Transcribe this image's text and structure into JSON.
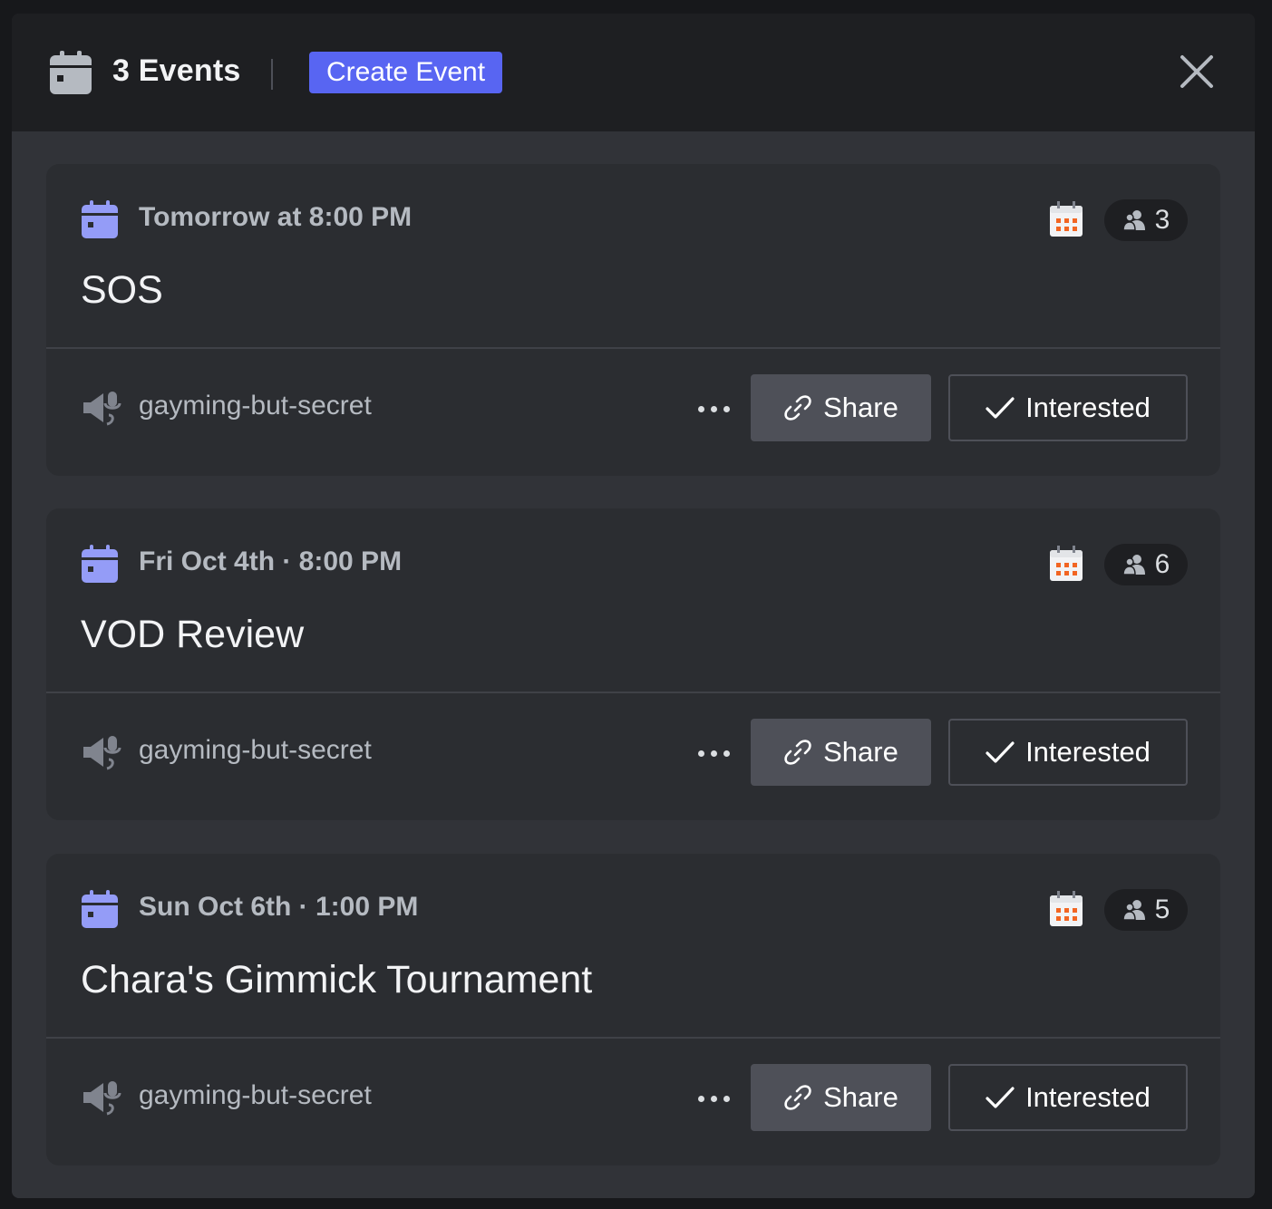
{
  "header": {
    "title": "3 Events",
    "create_label": "Create Event",
    "icon": "calendar-icon",
    "close_icon": "close-icon"
  },
  "events": [
    {
      "time": "Tomorrow at 8:00 PM",
      "title": "SOS",
      "interested_count": "3",
      "location": "gayming-but-secret",
      "share_label": "Share",
      "interested_label": "Interested"
    },
    {
      "time": "Fri Oct 4th · 8:00 PM",
      "title": "VOD Review",
      "interested_count": "6",
      "location": "gayming-but-secret",
      "share_label": "Share",
      "interested_label": "Interested"
    },
    {
      "time": "Sun Oct 6th · 1:00 PM",
      "title": "Chara's Gimmick Tournament",
      "interested_count": "5",
      "location": "gayming-but-secret",
      "share_label": "Share",
      "interested_label": "Interested"
    }
  ],
  "colors": {
    "accent": "#5865f2",
    "event_icon": "#949cf7",
    "header_bg": "#1e1f22",
    "card_bg": "#2b2d31",
    "modal_bg": "#313338",
    "share_bg": "#4e5058"
  }
}
